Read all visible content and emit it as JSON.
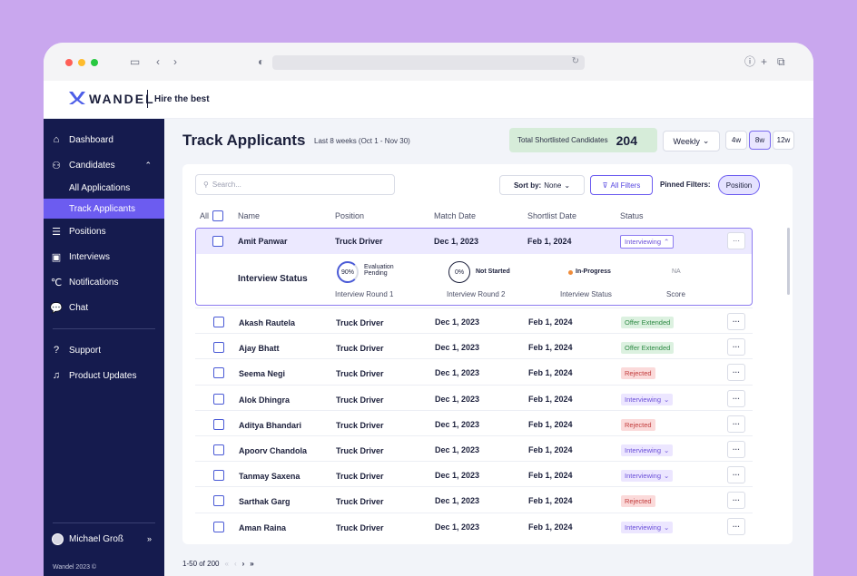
{
  "brand": {
    "name": "WANDEL",
    "tagline": "Hire the best"
  },
  "sidebar": {
    "items": [
      {
        "label": "Dashboard",
        "icon": "home-icon"
      },
      {
        "label": "Candidates",
        "icon": "users-icon"
      },
      {
        "label": "Positions",
        "icon": "list-icon"
      },
      {
        "label": "Interviews",
        "icon": "portrait-icon"
      },
      {
        "label": "Notifications",
        "icon": "bell-icon"
      },
      {
        "label": "Chat",
        "icon": "chat-icon"
      },
      {
        "label": "Support",
        "icon": "question-icon"
      },
      {
        "label": "Product Updates",
        "icon": "bell-outline-icon"
      }
    ],
    "subitems": [
      {
        "label": "All Applications"
      },
      {
        "label": "Track Applicants"
      }
    ],
    "user": "Michael Groß",
    "copyright": "Wandel 2023 ©"
  },
  "header": {
    "title": "Track Applicants",
    "subtitle": "Last 8 weeks (Oct 1 - Nov 30)",
    "shortlist_label": "Total Shortlisted Candidates",
    "shortlist_value": "204",
    "period": "Weekly",
    "ranges": [
      "4w",
      "8w",
      "12w"
    ],
    "selected_range": "8w"
  },
  "toolbar": {
    "search_placeholder": "Search...",
    "sort_label": "Sort by:",
    "sort_value": "None",
    "filters_label": "All Filters",
    "pinned_label": "Pinned Filters:",
    "pinned_chip": "Position"
  },
  "table": {
    "columns": [
      "All",
      "Name",
      "Position",
      "Match Date",
      "Shortlist Date",
      "Status"
    ],
    "expanded": {
      "name": "Amit Panwar",
      "position": "Truck Driver",
      "match_date": "Dec 1, 2023",
      "shortlist_date": "Feb 1, 2024",
      "status": "Interviewing",
      "detail_title": "Interview Status",
      "round1_percent": "90%",
      "round1_state": "Evaluation Pending",
      "round1_caption": "Interview Round 1",
      "round2_percent": "0%",
      "round2_state": "Not Started",
      "round2_caption": "Interview Round 2",
      "interview_state": "In-Progress",
      "interview_caption": "Interview Status",
      "score": "NA",
      "score_caption": "Score"
    },
    "rows": [
      {
        "name": "Akash Rautela",
        "position": "Truck Driver",
        "match_date": "Dec 1, 2023",
        "shortlist_date": "Feb 1, 2024",
        "status": "Offer Extended"
      },
      {
        "name": "Ajay Bhatt",
        "position": "Truck Driver",
        "match_date": "Dec 1, 2023",
        "shortlist_date": "Feb 1, 2024",
        "status": "Offer Extended"
      },
      {
        "name": "Seema Negi",
        "position": "Truck Driver",
        "match_date": "Dec 1, 2023",
        "shortlist_date": "Feb 1, 2024",
        "status": "Rejected"
      },
      {
        "name": "Alok Dhingra",
        "position": "Truck Driver",
        "match_date": "Dec 1, 2023",
        "shortlist_date": "Feb 1, 2024",
        "status": "Interviewing"
      },
      {
        "name": "Aditya Bhandari",
        "position": "Truck Driver",
        "match_date": "Dec 1, 2023",
        "shortlist_date": "Feb 1, 2024",
        "status": "Rejected"
      },
      {
        "name": "Apoorv Chandola",
        "position": "Truck Driver",
        "match_date": "Dec 1, 2023",
        "shortlist_date": "Feb 1, 2024",
        "status": "Interviewing"
      },
      {
        "name": "Tanmay Saxena",
        "position": "Truck Driver",
        "match_date": "Dec 1, 2023",
        "shortlist_date": "Feb 1, 2024",
        "status": "Interviewing"
      },
      {
        "name": "Sarthak Garg",
        "position": "Truck Driver",
        "match_date": "Dec 1, 2023",
        "shortlist_date": "Feb 1, 2024",
        "status": "Rejected"
      },
      {
        "name": "Aman Raina",
        "position": "Truck Driver",
        "match_date": "Dec 1, 2023",
        "shortlist_date": "Feb 1, 2024",
        "status": "Interviewing"
      }
    ]
  },
  "pager": {
    "range": "1-50 of 200"
  },
  "colors": {
    "accent": "#6c5cf0",
    "sidebar": "#151b4e",
    "background": "#c9a7ee"
  }
}
